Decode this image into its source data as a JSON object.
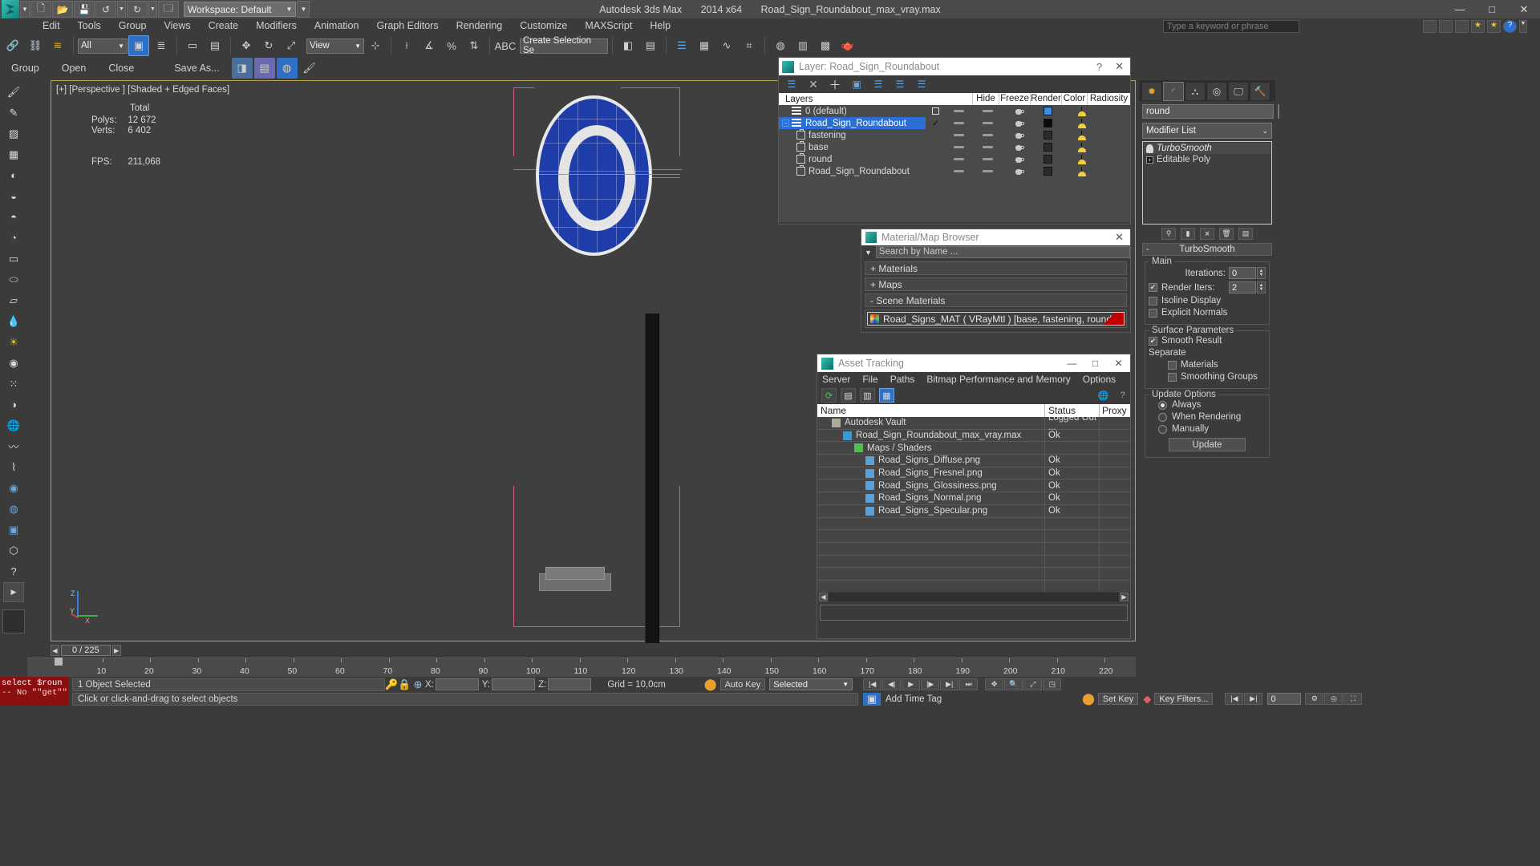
{
  "titlebar": {
    "app": "Autodesk 3ds Max",
    "version": "2014 x64",
    "file": "Road_Sign_Roundabout_max_vray.max",
    "workspace": "Workspace: Default",
    "min": "—",
    "max": "□",
    "close": "✕"
  },
  "menu": {
    "items": [
      "Edit",
      "Tools",
      "Group",
      "Views",
      "Create",
      "Modifiers",
      "Animation",
      "Graph Editors",
      "Rendering",
      "Customize",
      "MAXScript",
      "Help"
    ],
    "search_placeholder": "Type a keyword or phrase"
  },
  "toolbar": {
    "selection_filter": "All",
    "ref_coord": "View",
    "named_selection_set": "Create Selection Se"
  },
  "toolbar2": {
    "group": "Group",
    "open": "Open",
    "close": "Close",
    "save_as": "Save As..."
  },
  "viewport": {
    "label": "[+] [Perspective ] [Shaded + Edged Faces]",
    "stats_header": "Total",
    "stats": [
      {
        "label": "Polys:",
        "value": "12 672"
      },
      {
        "label": "Verts:",
        "value": "6 402"
      },
      {
        "label": "FPS:",
        "value": "211,068"
      }
    ],
    "axis_labels": {
      "z": "Z",
      "y": "Y",
      "x": "X"
    }
  },
  "layer_dialog": {
    "title": "Layer: Road_Sign_Roundabout",
    "help": "?",
    "close": "✕",
    "columns": [
      "Layers",
      "",
      "Hide",
      "Freeze",
      "Render",
      "Color",
      "Radiosity"
    ],
    "rows": [
      {
        "name": "0 (default)",
        "indent": 0,
        "icon": "layer-icon",
        "selected": false,
        "expander": "",
        "check": "box",
        "color": "#3f8fe0"
      },
      {
        "name": "Road_Sign_Roundabout",
        "indent": 0,
        "icon": "layer-icon",
        "selected": true,
        "expander": "−",
        "check": "tick",
        "color": "#0a0a0a"
      },
      {
        "name": "fastening",
        "indent": 1,
        "icon": "object-icon",
        "selected": false,
        "expander": "",
        "check": "",
        "color": "#2b2b2b"
      },
      {
        "name": "base",
        "indent": 1,
        "icon": "object-icon",
        "selected": false,
        "expander": "",
        "check": "",
        "color": "#2b2b2b"
      },
      {
        "name": "round",
        "indent": 1,
        "icon": "object-icon",
        "selected": false,
        "expander": "",
        "check": "",
        "color": "#2b2b2b"
      },
      {
        "name": "Road_Sign_Roundabout",
        "indent": 1,
        "icon": "object-icon",
        "selected": false,
        "expander": "",
        "check": "",
        "color": "#2b2b2b"
      }
    ]
  },
  "material_browser": {
    "title": "Material/Map Browser",
    "close": "✕",
    "search_placeholder": "Search by Name ...",
    "groups": [
      {
        "label": "+ Materials"
      },
      {
        "label": "+ Maps"
      },
      {
        "label": "-  Scene Materials"
      }
    ],
    "scene_material": "Road_Signs_MAT  ( VRayMtl )  [base, fastening, round]"
  },
  "asset_tracking": {
    "title": "Asset Tracking",
    "window_controls": [
      "—",
      "□",
      "✕"
    ],
    "menu": [
      "Server",
      "File",
      "Paths",
      "Bitmap Performance and Memory",
      "Options"
    ],
    "columns": {
      "name": "Name",
      "status": "Status",
      "proxy": "Proxy"
    },
    "rows": [
      {
        "name": "Autodesk Vault",
        "indent": 1,
        "status": "Logged Out ...",
        "icon": "vault-icon"
      },
      {
        "name": "Road_Sign_Roundabout_max_vray.max",
        "indent": 2,
        "status": "Ok",
        "icon": "max-file-icon"
      },
      {
        "name": "Maps / Shaders",
        "indent": 3,
        "status": "",
        "icon": "maps-icon"
      },
      {
        "name": "Road_Signs_Diffuse.png",
        "indent": 4,
        "status": "Ok",
        "icon": "bitmap-icon"
      },
      {
        "name": "Road_Signs_Fresnel.png",
        "indent": 4,
        "status": "Ok",
        "icon": "bitmap-icon"
      },
      {
        "name": "Road_Signs_Glossiness.png",
        "indent": 4,
        "status": "Ok",
        "icon": "bitmap-icon"
      },
      {
        "name": "Road_Signs_Normal.png",
        "indent": 4,
        "status": "Ok",
        "icon": "bitmap-icon"
      },
      {
        "name": "Road_Signs_Specular.png",
        "indent": 4,
        "status": "Ok",
        "icon": "bitmap-icon"
      },
      {
        "name": "",
        "indent": 0,
        "status": "",
        "icon": ""
      },
      {
        "name": "",
        "indent": 0,
        "status": "",
        "icon": ""
      },
      {
        "name": "",
        "indent": 0,
        "status": "",
        "icon": ""
      },
      {
        "name": "",
        "indent": 0,
        "status": "",
        "icon": ""
      },
      {
        "name": "",
        "indent": 0,
        "status": "",
        "icon": ""
      },
      {
        "name": "",
        "indent": 0,
        "status": "",
        "icon": ""
      }
    ]
  },
  "command_panel": {
    "object_name": "round",
    "modifier_list": "Modifier List",
    "stack": [
      {
        "label": "TurboSmooth",
        "current": true
      },
      {
        "label": "Editable Poly",
        "current": false
      }
    ],
    "rollup": {
      "title": "TurboSmooth",
      "collapse": "-",
      "main_group": "Main",
      "iterations_label": "Iterations:",
      "iterations_value": "0",
      "render_iters_label": "Render Iters:",
      "render_iters_value": "2",
      "render_iters_checked": true,
      "isoline_display": "Isoline Display",
      "explicit_normals": "Explicit Normals",
      "surface_group": "Surface Parameters",
      "smooth_result": "Smooth Result",
      "smooth_result_checked": true,
      "separate": "Separate",
      "separate_materials": "Materials",
      "separate_smoothing_groups": "Smoothing Groups",
      "update_group": "Update Options",
      "update_always": "Always",
      "update_when_rendering": "When Rendering",
      "update_manually": "Manually",
      "update_selected": "Always",
      "update_button": "Update"
    }
  },
  "timeline": {
    "current_frame": "0 / 225",
    "ticks": [
      "10",
      "20",
      "30",
      "40",
      "50",
      "60",
      "70",
      "80",
      "90",
      "100",
      "110",
      "120",
      "130",
      "140",
      "150",
      "160",
      "170",
      "180",
      "190",
      "200",
      "210",
      "220"
    ]
  },
  "status_bar": {
    "maxscript_prompt": "select $roun",
    "maxscript_out": "-- No \"\"get\"\"",
    "selection_text": "1 Object Selected",
    "hint_text": "Click or click-and-drag to select objects",
    "coord_labels": {
      "x": "X:",
      "y": "Y:",
      "z": "Z:"
    },
    "coord_values": {
      "x": "",
      "y": "",
      "z": ""
    },
    "grid": "Grid = 10,0cm",
    "auto_key": "Auto Key",
    "set_key": "Set Key",
    "key_filters": "Key Filters...",
    "selected_dropdown": "Selected",
    "add_time_tag": "Add Time Tag",
    "spinner_value": "0"
  },
  "colors": {
    "accent_blue": "#2a6fd6",
    "sign_blue": "#1f3da8",
    "helper_pink": "#e8609c",
    "viewport_border": "#b8a254",
    "listener_red": "#8a0f0f",
    "radiosity_yellow": "#f2cf3c"
  }
}
